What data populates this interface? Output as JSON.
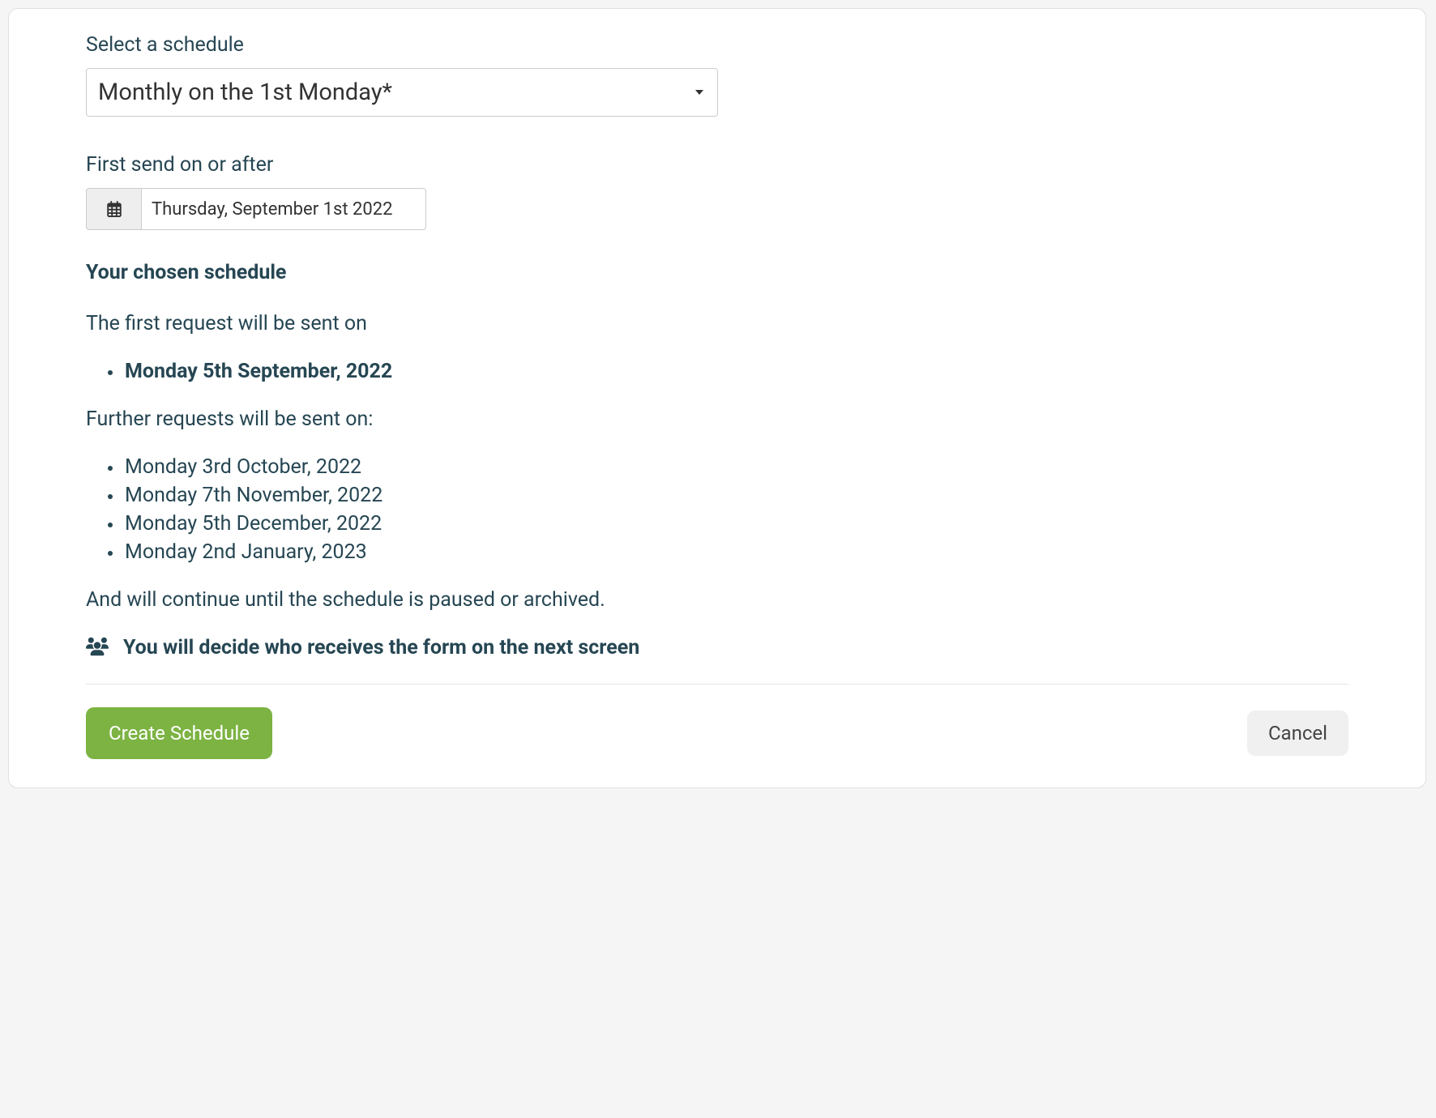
{
  "scheduleSelect": {
    "label": "Select a schedule",
    "value": "Monthly on the 1st Monday*"
  },
  "firstSend": {
    "label": "First send on or after",
    "value": "Thursday, September 1st 2022"
  },
  "chosenSchedule": {
    "heading": "Your chosen schedule",
    "firstRequestText": "The first request will be sent on",
    "firstDate": "Monday 5th September, 2022",
    "furtherText": "Further requests will be sent on:",
    "furtherDates": [
      "Monday 3rd October, 2022",
      "Monday 7th November, 2022",
      "Monday 5th December, 2022",
      "Monday 2nd January, 2023"
    ],
    "continueText": "And will continue until the schedule is paused or archived."
  },
  "recipientsInfo": "You will decide who receives the form on the next screen",
  "buttons": {
    "create": "Create Schedule",
    "cancel": "Cancel"
  }
}
